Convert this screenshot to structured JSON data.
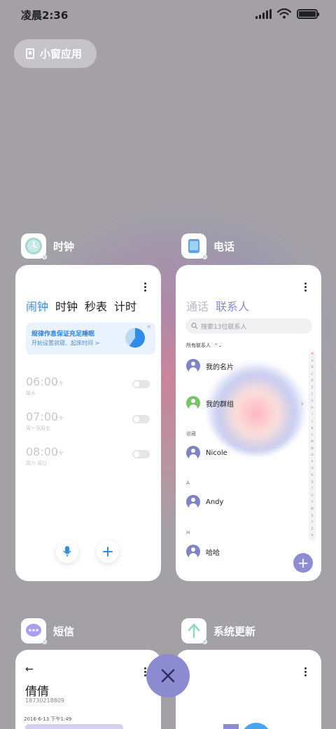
{
  "status_bar": {
    "time": "凌晨2:36"
  },
  "small_window": {
    "label": "小窗应用"
  },
  "apps": {
    "clock": {
      "name": "时钟",
      "tabs": [
        "闹钟",
        "时钟",
        "秒表",
        "计时"
      ],
      "promo": {
        "title": "规律作息保证充足睡眠",
        "subtitle": "开始设置就寝、起床时间 >"
      },
      "alarms": [
        {
          "time": "06:00",
          "ampm": "上午",
          "repeat": "每天"
        },
        {
          "time": "07:00",
          "ampm": "上午",
          "repeat": "周一至周五"
        },
        {
          "time": "08:00",
          "ampm": "上午",
          "repeat": "周六 周日"
        }
      ]
    },
    "phone": {
      "name": "电话",
      "tabs": [
        "通话",
        "联系人"
      ],
      "search_placeholder": "搜索13位联系人",
      "list_header": "所有联系人",
      "section_fav": "收藏",
      "section_a": "A",
      "section_h": "H",
      "contacts": [
        "我的名片",
        "我的群组",
        "Nicole",
        "Andy",
        "哈哈"
      ],
      "alphabet": [
        "❤",
        "A",
        "B",
        "C",
        "D",
        "E",
        "F",
        "G",
        "H",
        "I",
        "J",
        "K",
        "L",
        "M",
        "N",
        "O",
        "P",
        "Q",
        "R",
        "S",
        "T",
        "U",
        "V",
        "W",
        "X",
        "Y",
        "Z",
        "#"
      ]
    },
    "sms": {
      "name": "短信",
      "contact_name": "倩倩",
      "number": "18730218809",
      "date": "2016-6-13 下午1:49"
    },
    "update": {
      "name": "系统更新"
    }
  },
  "colors": {
    "accent_blue": "#2e8de8",
    "accent_purple": "#8c8bd2"
  }
}
